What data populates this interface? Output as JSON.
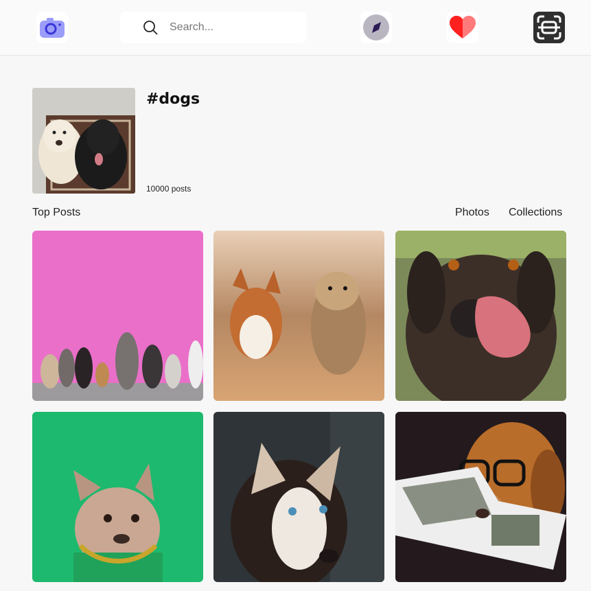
{
  "topbar": {
    "search": {
      "placeholder": "Search..."
    },
    "icons": [
      "camera-icon",
      "search-icon",
      "compass-icon",
      "heart-icon",
      "scan-icon"
    ]
  },
  "hashtag": {
    "title": "#dogs",
    "post_count": "10000 posts"
  },
  "sections": {
    "top_posts": "Top Posts",
    "tabs": [
      "Photos",
      "Collections"
    ]
  },
  "colors": {
    "accent": "#5b5ef7",
    "heart": "#ff2a2a",
    "page_bg": "#f7f7f7"
  }
}
